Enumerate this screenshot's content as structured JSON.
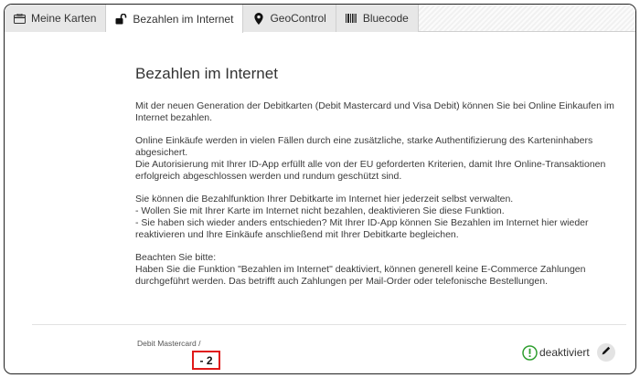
{
  "tabs": [
    {
      "label": "Meine Karten",
      "icon": "card-icon",
      "active": false
    },
    {
      "label": "Bezahlen im Internet",
      "icon": "unlock-icon",
      "active": true
    },
    {
      "label": "GeoControl",
      "icon": "map-pin-icon",
      "active": false
    },
    {
      "label": "Bluecode",
      "icon": "barcode-icon",
      "active": false
    }
  ],
  "main": {
    "title": "Bezahlen im Internet",
    "paragraphs": [
      [
        "Mit der neuen Generation der Debitkarten (Debit Mastercard und Visa Debit) können Sie bei Online Einkaufen im Internet bezahlen."
      ],
      [
        "Online Einkäufe werden in vielen Fällen durch eine zusätzliche, starke Authentifizierung des Karteninhabers abgesichert.",
        "Die Autorisierung mit Ihrer ID-App erfüllt alle von der EU geforderten Kriterien, damit Ihre Online-Transaktionen erfolgreich abgeschlossen werden und rundum geschützt sind."
      ],
      [
        "Sie können die Bezahlfunktion Ihrer Debitkarte im Internet hier jederzeit selbst verwalten.",
        "- Wollen Sie mit Ihrer Karte im Internet nicht bezahlen, deaktivieren Sie diese Funktion.",
        "- Sie haben sich wieder anders entschieden? Mit Ihrer ID-App können Sie Bezahlen im Internet hier wieder reaktivieren und Ihre Einkäufe anschließend mit Ihrer Debitkarte begleichen."
      ],
      [
        "Beachten Sie bitte:",
        "Haben Sie die Funktion \"Bezahlen im Internet\" deaktiviert, können generell keine E-Commerce Zahlungen durchgeführt werden. Das betrifft auch Zahlungen per Mail-Order oder telefonische Bestellungen."
      ]
    ]
  },
  "card": {
    "label": "Debit Mastercard /",
    "number": "- 2",
    "status": "deaktiviert",
    "status_icon": "exclamation-circle-icon",
    "edit_icon": "pencil-icon",
    "colors": {
      "status": "#2f9e2f",
      "highlight": "#e01919"
    }
  }
}
